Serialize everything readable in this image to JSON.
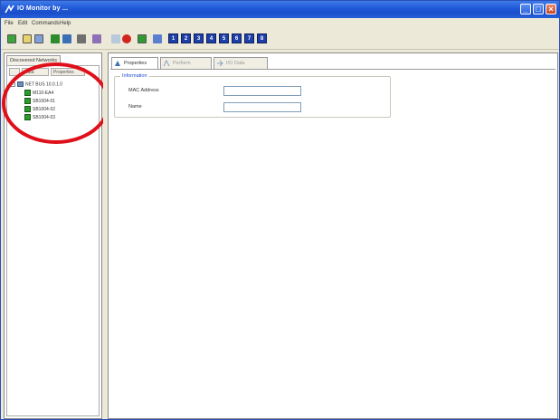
{
  "window": {
    "title": "IO Monitor by ...",
    "colors": {
      "titlebar": "#1f58d8",
      "chrome": "#ece9d8",
      "accent": "#1f4fc9"
    }
  },
  "menu": {
    "items": [
      "File",
      "Edit",
      "Commands",
      "Help"
    ]
  },
  "toolbar": {
    "icons": [
      "connect-icon",
      "open-icon",
      "save-icon",
      "device-icon",
      "arrow-icon",
      "scan-icon",
      "refresh-icon",
      "stop-icon",
      "monitor-icon",
      "wand-icon"
    ],
    "numbered_buttons": [
      "1",
      "2",
      "3",
      "4",
      "5",
      "6",
      "7",
      "8"
    ]
  },
  "left_pane": {
    "tab_label": "Discovered Networks",
    "subtabs": [
      "",
      "Data",
      "Properties"
    ],
    "tree": {
      "root_label": "NET BUS 10.0.1.0",
      "children": [
        "M110-EA4",
        "SB1004-01",
        "SB1004-02",
        "SB1004-03"
      ]
    }
  },
  "right_pane": {
    "tabs": [
      "Properties",
      "Perform",
      "I/O Data"
    ],
    "group_title": "Information",
    "fields": [
      {
        "label": "MAC Address",
        "value": ""
      },
      {
        "label": "Name",
        "value": ""
      }
    ]
  }
}
